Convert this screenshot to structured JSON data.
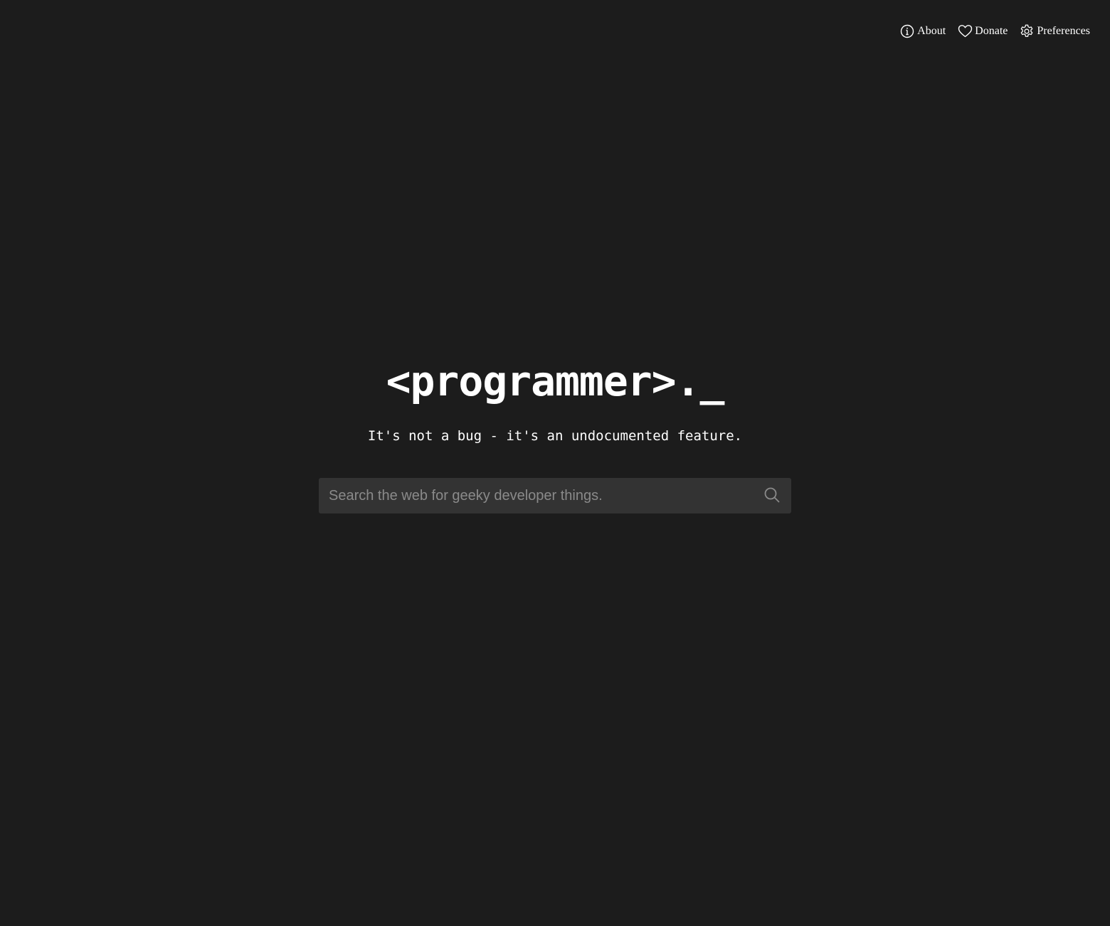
{
  "nav": {
    "items": [
      {
        "label": "About",
        "icon": "info-icon"
      },
      {
        "label": "Donate",
        "icon": "heart-icon"
      },
      {
        "label": "Preferences",
        "icon": "gear-icon"
      }
    ]
  },
  "hero": {
    "logo": "<programmer>._",
    "tagline": "It's not a bug - it's an undocumented feature."
  },
  "search": {
    "placeholder": "Search the web for geeky developer things.",
    "value": "",
    "button_icon": "search-icon"
  },
  "colors": {
    "background": "#1c1c1c",
    "search_bg": "#333333",
    "text": "#ffffff",
    "placeholder": "#8a8a8a"
  }
}
